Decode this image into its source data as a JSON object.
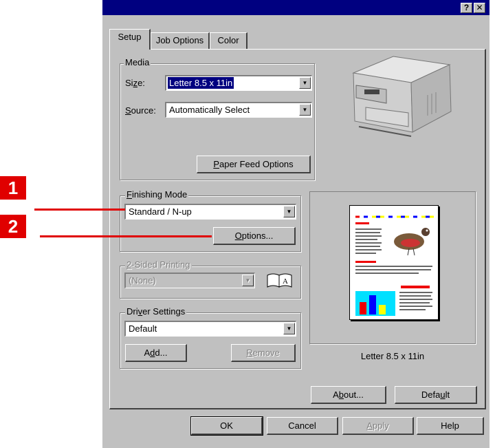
{
  "titlebar": {
    "help_btn": "?",
    "close_btn": "✕"
  },
  "tabs": [
    {
      "label": "Setup"
    },
    {
      "label": "Job Options"
    },
    {
      "label": "Color"
    }
  ],
  "media": {
    "group_label": "Media",
    "size_label_pre": "Si",
    "size_label_ul": "z",
    "size_label_post": "e:",
    "size_value": "Letter 8.5 x 11in",
    "source_label_ul": "S",
    "source_label_post": "ource:",
    "source_value": "Automatically Select",
    "paper_feed_ul": "P",
    "paper_feed_post": "aper Feed Options"
  },
  "finishing": {
    "group_label_ul": "F",
    "group_label_post": "inishing Mode",
    "value": "Standard / N-up",
    "options_ul": "O",
    "options_post": "ptions..."
  },
  "two_sided": {
    "group_label_ul": "2",
    "group_label_post": "-Sided Printing",
    "value": "(None)"
  },
  "driver": {
    "group_label_pre": "Dri",
    "group_label_ul": "v",
    "group_label_post": "er Settings",
    "value": "Default",
    "add_pre": "A",
    "add_ul": "d",
    "add_post": "d...",
    "remove_ul": "R",
    "remove_post": "emove"
  },
  "preview": {
    "caption": "Letter 8.5 x 11in"
  },
  "buttons": {
    "about_pre": "A",
    "about_ul": "b",
    "about_post": "out...",
    "default_pre": "Defa",
    "default_ul": "u",
    "default_post": "lt",
    "ok": "OK",
    "cancel": "Cancel",
    "apply_ul": "A",
    "apply_post": "pply",
    "help": "Help"
  },
  "callouts": {
    "one": "1",
    "two": "2"
  },
  "colors": {
    "titlebar": "#000080",
    "dialog": "#c0c0c0",
    "callout": "#e00000"
  }
}
